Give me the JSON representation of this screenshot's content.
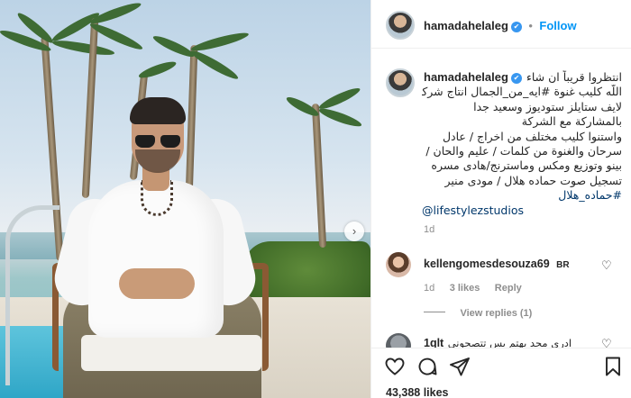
{
  "post": {
    "username": "hamadahelaleg",
    "follow_label": "Follow",
    "verified_mark": "✔",
    "more_label": "•••"
  },
  "caption": {
    "author": "hamadahelaleg",
    "lines": [
      "انتظروا قريباً ان شاء",
      "اللّه كليب غنوة #ايه_من_الجمال انتاج شركة",
      "لايف ستايلز ستوديوز وسعيد جدا",
      "بالمشاركة مع الشركة",
      "واستنوا كليب مختلف من اخراج / عادل",
      "سرحان والغنوة من كلمات / عليم والحان /",
      "بينو وتوزيع ومكس وماسترنج/هادى مسره",
      "تسجيل صوت حماده هلال / مودى منير"
    ],
    "hashtag": "#حماده_هلال",
    "mention": "@lifestylezstudios",
    "time": "1d"
  },
  "comments": [
    {
      "username": "kellengomesdesouza69",
      "text": "BR",
      "time": "1d",
      "likes": "3 likes",
      "reply_label": "Reply",
      "view_replies": "View replies (1)"
    },
    {
      "username": "1qlt",
      "text": "ادري مجد بهتم بس تتصحوني"
    }
  ],
  "actions": {
    "likes_count": "43,388 likes"
  },
  "photo": {
    "next_label": "›"
  }
}
